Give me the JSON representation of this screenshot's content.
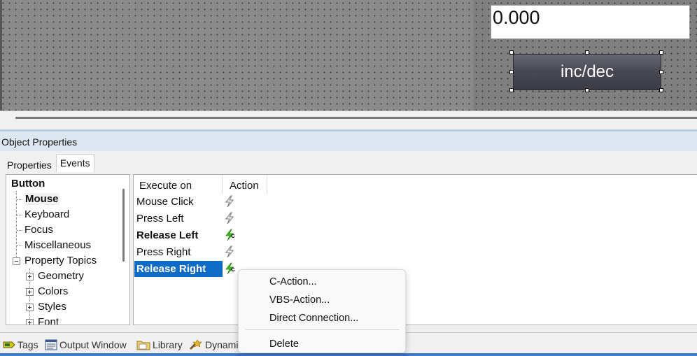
{
  "canvas": {
    "io_field_value": "0.000",
    "button_label": "inc/dec"
  },
  "panel": {
    "title": "Object Properties",
    "tabs": [
      {
        "label": "Properties",
        "active": false
      },
      {
        "label": "Events",
        "active": true
      }
    ]
  },
  "tree": {
    "root": "Button",
    "items": [
      {
        "label": "Mouse",
        "bold": true
      },
      {
        "label": "Keyboard"
      },
      {
        "label": "Focus"
      },
      {
        "label": "Miscellaneous"
      },
      {
        "label": "Property Topics",
        "expanded": true
      },
      {
        "label": "Geometry"
      },
      {
        "label": "Colors"
      },
      {
        "label": "Styles"
      },
      {
        "label": "Font"
      }
    ]
  },
  "events": {
    "headers": {
      "execute_on": "Execute on",
      "action": "Action"
    },
    "rows": [
      {
        "label": "Mouse Click",
        "has_action": false
      },
      {
        "label": "Press Left",
        "has_action": false
      },
      {
        "label": "Release Left",
        "has_action": true,
        "action_badge": "c"
      },
      {
        "label": "Press Right",
        "has_action": false
      },
      {
        "label": "Release Right",
        "has_action": true,
        "action_badge": "c",
        "selected": true
      }
    ]
  },
  "context_menu": {
    "items": [
      "C-Action...",
      "VBS-Action...",
      "Direct Connection..."
    ],
    "delete_label": "Delete"
  },
  "bottom_tabs": [
    {
      "label": "Tags",
      "icon": "tag-icon"
    },
    {
      "label": "Output Window",
      "icon": "output-window-icon"
    },
    {
      "label": "Library",
      "icon": "library-folder-icon"
    },
    {
      "label": "Dynami",
      "icon": "dynamic-wizard-icon"
    }
  ],
  "colors": {
    "selection": "#0e6cc8",
    "action_bolt_active": "#3dbb1f",
    "action_bolt_inactive": "#8a8a8a"
  }
}
